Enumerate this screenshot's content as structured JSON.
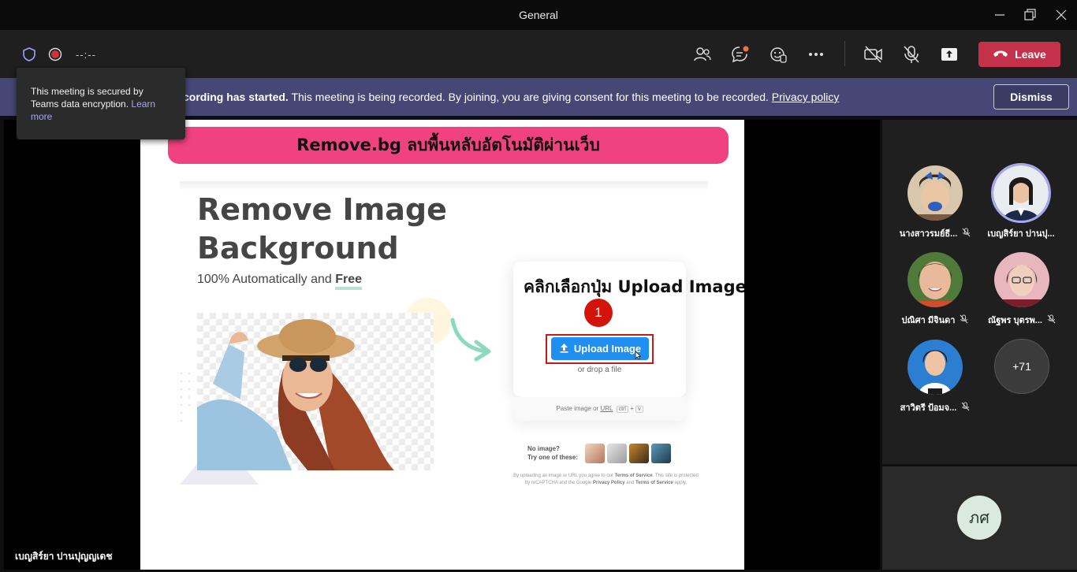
{
  "window": {
    "title": "General"
  },
  "toolbar": {
    "timer": "--:--",
    "leave_label": "Leave"
  },
  "banner": {
    "bold_text": "cording has started.",
    "text": " This meeting is being recorded. By joining, you are giving consent for this meeting to be recorded. ",
    "link": "Privacy policy",
    "dismiss_label": "Dismiss"
  },
  "tooltip": {
    "text": "This meeting is secured by Teams data encryption. ",
    "link": "Learn more"
  },
  "share": {
    "banner": "Remove.bg ลบพื้นหลับอัตโนมัติผ่านเว็บ",
    "headline_1": "Remove Image",
    "headline_2": "Background",
    "sub_prefix": "100% Automatically and ",
    "sub_bold": "Free",
    "overlay_text": "คลิกเลือกปุ่ม Upload Image",
    "badge_number": "1",
    "upload_label": "Upload Image",
    "drop_text": "or drop a file",
    "paste_text": "Paste image or ",
    "paste_url": "URL",
    "kbd_ctrl": "ctrl",
    "kbd_plus": "+",
    "kbd_v": "v",
    "no_image": "No image?",
    "try_these": "Try one of these:",
    "legal_1": "By uploading an image or URL you agree to our ",
    "legal_tos": "Terms of Service",
    "legal_2": ". This site is protected by reCAPTCHA and the Google ",
    "legal_pp": "Privacy Policy",
    "legal_3": " and ",
    "legal_tos2": "Terms of Service",
    "legal_4": " apply."
  },
  "presenter_name": "เบญสิร์ยา ปานปุญญเดช",
  "participants": [
    {
      "name": "นางสาวรมย์ธี..."
    },
    {
      "name": "เบญสิร์ยา ปานปุ..."
    },
    {
      "name": "ปณิศา มีจินดา"
    },
    {
      "name": "ณัฐพร บุตรพ..."
    },
    {
      "name": "สาวิตรี ป้อมจ..."
    }
  ],
  "more_count": "+71",
  "self_initials": "ภศ",
  "colors": {
    "leave": "#c4314b",
    "banner": "#464775",
    "upload": "#1f8ff1",
    "pink": "#f0427e"
  }
}
